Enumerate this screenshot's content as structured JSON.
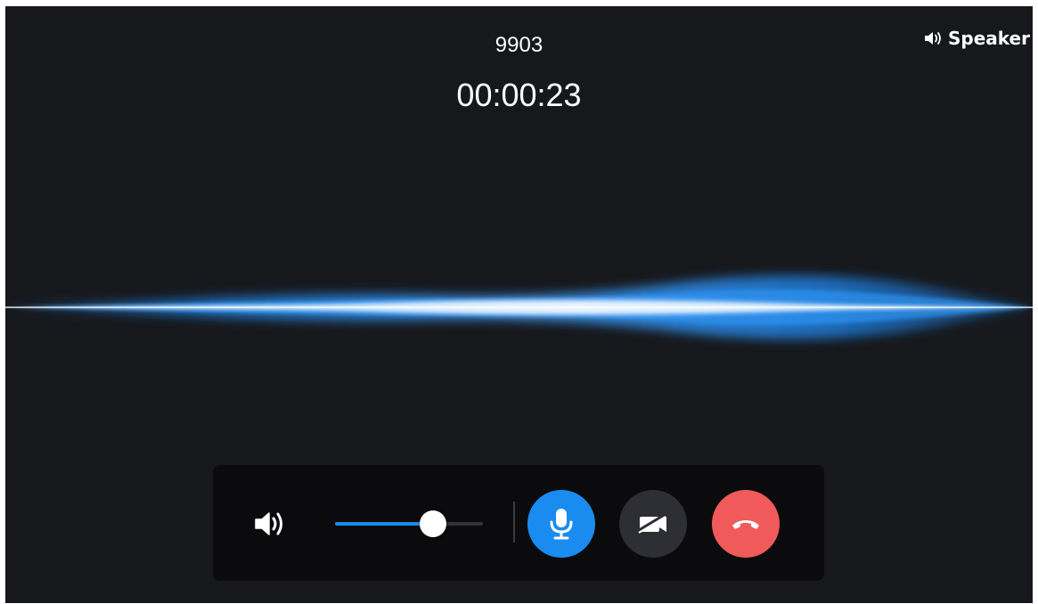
{
  "call": {
    "number": "9903",
    "duration": "00:00:23"
  },
  "speaker_indicator": {
    "label": "Speaker",
    "icon": "speaker-icon"
  },
  "controls": {
    "volume_icon": "volume-icon",
    "volume_level": 0.66,
    "mic_button": {
      "icon": "microphone-icon",
      "color": "#1a8cf0"
    },
    "video_button": {
      "icon": "video-camera-icon",
      "color": "#2d2f34"
    },
    "hangup_button": {
      "icon": "phone-hangup-icon",
      "color": "#f05a5a"
    }
  },
  "colors": {
    "background": "#17181c",
    "control_bar": "#0b0b0d",
    "accent": "#1a8cf0",
    "hangup": "#f05a5a"
  }
}
